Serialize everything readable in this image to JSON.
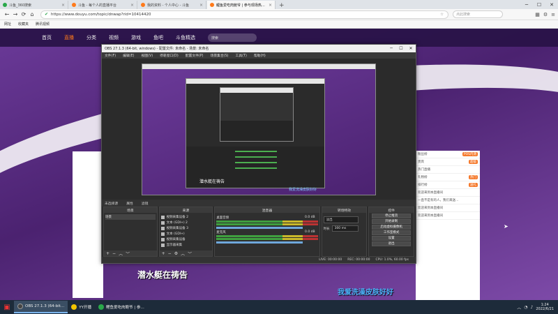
{
  "browser": {
    "tabs": [
      {
        "label": "斗鱼_360搜索",
        "fav_color": "#2aa84a"
      },
      {
        "label": "斗鱼 - 每个人的直播平台",
        "fav_color": "#ff7a1a"
      },
      {
        "label": "我的资料 - 个人中心 - 斗鱼",
        "fav_color": "#ff7a1a"
      },
      {
        "label": "鲤鱼爱吃肉鲍爷 | 参与现场热…",
        "fav_color": "#ff7a1a"
      }
    ],
    "url": "https://www.douyu.com/topic/dnwap?rid=10414420",
    "search_placeholder": "点此搜索",
    "bookmarks": [
      "网址",
      "收藏夹",
      "腾讯视频"
    ]
  },
  "site": {
    "nav": [
      "首页",
      "直播",
      "分类",
      "视频",
      "游戏",
      "鱼吧",
      "斗鱼精选"
    ],
    "search_placeholder": "搜索",
    "right_list": [
      {
        "text": "粉丝榜",
        "tag": "POS内测"
      },
      {
        "text": "贵宾",
        "tag": "超级"
      },
      {
        "text": "热门直播",
        "tag": ""
      },
      {
        "text": "礼物榜",
        "tag": "热门"
      },
      {
        "text": "排行榜",
        "tag": "送礼"
      },
      {
        "text": "欢迎来到本直播间",
        "tag": ""
      },
      {
        "text": "一直不是有的人，我们来送…",
        "tag": ""
      },
      {
        "text": "欢迎来到本直播间",
        "tag": ""
      },
      {
        "text": "欢迎来到本直播间",
        "tag": ""
      }
    ]
  },
  "obs": {
    "title": "OBS 27.1.3 (64-bit, windows) - 配置文件: 未命名 - 场景: 未命名",
    "menu": [
      "文件(F)",
      "编辑(E)",
      "视图(V)",
      "停靠窗口(D)",
      "配置文件(P)",
      "场景集合(S)",
      "工具(T)",
      "帮助(H)"
    ],
    "scene_bar": [
      "未选择源",
      "属性",
      "滤镜"
    ],
    "docks": {
      "scenes": {
        "title": "场景",
        "items": [
          "场景"
        ]
      },
      "sources": {
        "title": "来源",
        "items": [
          "视频采集设备 2",
          "文本 (GDI+) 2",
          "视频采集设备 3",
          "文本 (GDI+)",
          "视频采集设备",
          "显示器采集"
        ]
      },
      "mixer": {
        "title": "混音器",
        "channels": [
          {
            "name": "桌面音频",
            "db": "0.0 dB"
          },
          {
            "name": "麦克风",
            "db": "0.0 dB"
          }
        ]
      },
      "transitions": {
        "title": "转场特效",
        "type": "淡出",
        "duration_label": "时长",
        "duration": "300 ms"
      },
      "controls": {
        "title": "控件",
        "buttons": [
          "停止推流",
          "开始录制",
          "启动虚拟摄像机",
          "工作室模式",
          "设置",
          "退出"
        ]
      }
    },
    "status": [
      "LIVE: 00:00:00",
      "REC: 00:00:00",
      "CPU: 1.0%, 60.00 fps"
    ],
    "preview_caption": "潜水艇在祷告",
    "preview_caption2": "我爱洗澡皮肤好好"
  },
  "overlay": {
    "subtitle_main": "潜水艇在祷告",
    "subtitle_side": "我爱洗澡皮肤好好"
  },
  "taskbar": {
    "items": [
      {
        "label": "OBS 27.1.3 (64-bit…",
        "color": "#444",
        "active": true
      },
      {
        "label": "YY开播",
        "color": "#f2c400",
        "active": false
      },
      {
        "label": "鲤鱼爱吃肉鲍爷 | 参…",
        "color": "#2aa84a",
        "active": false
      }
    ],
    "time": "1:24",
    "date": "2022/6/21"
  }
}
